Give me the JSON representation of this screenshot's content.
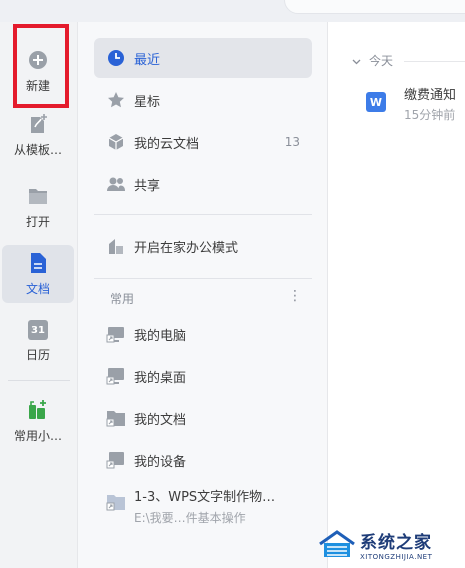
{
  "leftbar": {
    "items": [
      {
        "id": "new",
        "label": "新建",
        "icon": "plus-circle-icon"
      },
      {
        "id": "template",
        "label": "从模板…",
        "icon": "template-icon"
      },
      {
        "id": "open",
        "label": "打开",
        "icon": "folder-icon"
      },
      {
        "id": "docs",
        "label": "文档",
        "icon": "document-icon",
        "active": true
      },
      {
        "id": "calendar",
        "label": "日历",
        "icon": "calendar-icon",
        "day": "31"
      },
      {
        "id": "tools",
        "label": "常用小…",
        "icon": "tools-icon"
      }
    ]
  },
  "nav": {
    "primary": [
      {
        "label": "最近",
        "icon": "clock-icon",
        "active": true
      },
      {
        "label": "星标",
        "icon": "star-icon"
      },
      {
        "label": "我的云文档",
        "icon": "cloud-doc-icon",
        "count": "13"
      },
      {
        "label": "共享",
        "icon": "people-icon"
      }
    ],
    "mode": {
      "label": "开启在家办公模式",
      "icon": "home-office-icon"
    },
    "section_title": "常用",
    "section_more": "⋮",
    "frequent": [
      {
        "label": "我的电脑",
        "icon": "computer-shortcut-icon"
      },
      {
        "label": "我的桌面",
        "icon": "desktop-shortcut-icon"
      },
      {
        "label": "我的文档",
        "icon": "folder-shortcut-icon"
      },
      {
        "label": "我的设备",
        "icon": "device-shortcut-icon"
      },
      {
        "label": "1-3、WPS文字制作物…",
        "sub": "E:\\我要…件基本操作",
        "icon": "folder-shortcut-icon"
      }
    ]
  },
  "main": {
    "group_label": "今天",
    "files": [
      {
        "name": "缴费通知",
        "time": "15分钟前",
        "icon_letter": "W"
      }
    ]
  },
  "watermark": {
    "main": "系统之家",
    "sub": "XITONGZHIJIA.NET"
  },
  "colors": {
    "accent": "#2a62d6",
    "highlight": "#e41b2c",
    "icon_gray": "#9aa0a8",
    "doc_blue": "#3d7ce8",
    "tools_green": "#3aa64a"
  }
}
